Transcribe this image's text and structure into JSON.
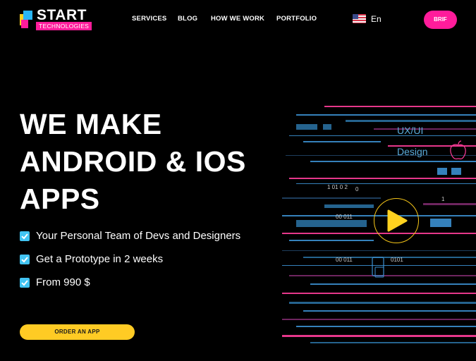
{
  "header": {
    "logo": {
      "brand": "START",
      "sub": "TECHNOLOGIES"
    },
    "nav": [
      {
        "label": "SERVICES"
      },
      {
        "label": "BLOG"
      },
      {
        "label": "HOW WE WORK"
      },
      {
        "label": "PORTFOLIO"
      }
    ],
    "language": {
      "code": "En",
      "flag": "us-flag-icon"
    },
    "brif_label": "BRIF"
  },
  "hero": {
    "title_lines": [
      "WE MAKE",
      "ANDROID & IOS",
      "APPS"
    ],
    "features": [
      "Your Personal Team of Devs and Designers",
      "Get a Prototype in 2 weeks",
      "From 990 $"
    ],
    "cta_label": "ORDER AN APP"
  },
  "visual": {
    "labels": {
      "uxui": "UX/UI",
      "design": "Design"
    },
    "code_snippets": [
      "1  01 0 2",
      "00 011",
      "00 011",
      "0101",
      "0",
      "1"
    ],
    "icons": [
      "apple-icon",
      "phone-icon",
      "play-icon"
    ]
  },
  "colors": {
    "accent_pink": "#ff1c9b",
    "accent_yellow": "#ffcb24",
    "accent_blue": "#42c4f2",
    "background": "#000000"
  }
}
